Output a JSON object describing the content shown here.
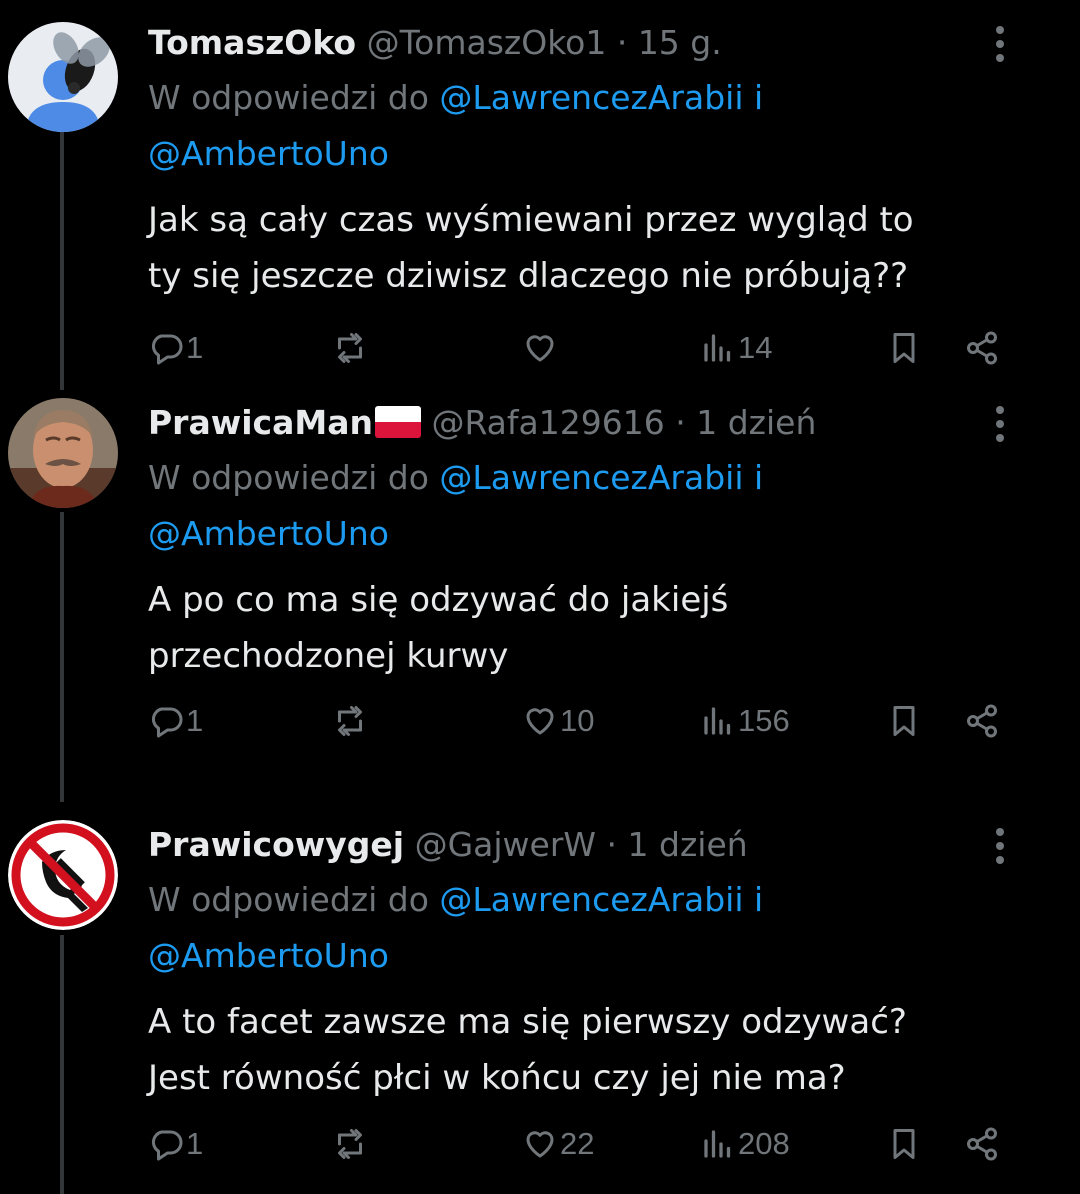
{
  "tweets": [
    {
      "name": "TomaszOko",
      "flag": "",
      "handle": "@TomaszOko1",
      "separator": "·",
      "time": "15 g.",
      "reply_prefix": "W odpowiedzi do",
      "mention1": "@LawrencezArabii",
      "mention_join": "i",
      "mention2": "@AmbertoUno",
      "text_line1": "Jak są cały czas wyśmiewani przez wygląd to",
      "text_line2": "ty się jeszcze dziwisz dlaczego nie próbują??",
      "replies": "1",
      "retweets": "",
      "likes": "",
      "views": "14",
      "avatar": "default-avatar-with-fly"
    },
    {
      "name": "PrawicaMan",
      "flag": "poland-flag",
      "handle": "@Rafa129616",
      "separator": "·",
      "time": "1 dzień",
      "reply_prefix": "W odpowiedzi do",
      "mention1": "@LawrencezArabii",
      "mention_join": "i",
      "mention2": "@AmbertoUno",
      "text_line1": "A po co ma się odzywać do jakiejś",
      "text_line2": "przechodzonej kurwy",
      "replies": "1",
      "retweets": "",
      "likes": "10",
      "views": "156",
      "avatar": "man-with-mustache-photo"
    },
    {
      "name": "Prawicowygej",
      "flag": "",
      "handle": "@GajwerW",
      "separator": "·",
      "time": "1 dzień",
      "reply_prefix": "W odpowiedzi do",
      "mention1": "@LawrencezArabii",
      "mention_join": "i",
      "mention2": "@AmbertoUno",
      "text_line1": "A to facet zawsze ma się pierwszy odzywać?",
      "text_line2": "Jest równość płci w końcu czy jej nie ma?",
      "replies": "1",
      "retweets": "",
      "likes": "22",
      "views": "208",
      "avatar": "no-communism-sign"
    }
  ],
  "colors": {
    "background": "#000000",
    "text": "#e7e9ea",
    "muted": "#71767b",
    "link": "#1d9bf0",
    "thread_line": "#333639"
  }
}
